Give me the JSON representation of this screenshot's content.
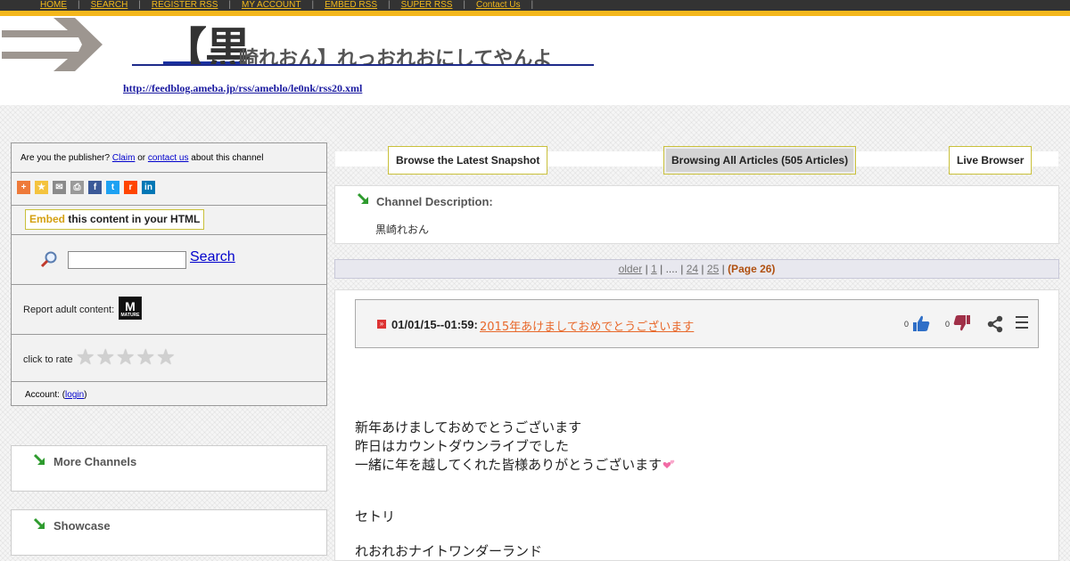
{
  "nav": {
    "items": [
      "HOME",
      "SEARCH",
      "REGISTER RSS",
      "MY ACCOUNT",
      "EMBED RSS",
      "SUPER RSS",
      "Contact Us"
    ],
    "separator": "|"
  },
  "header": {
    "title_big": "【黒",
    "title_rest": "崎れおん】れっおれおにしてやんよ",
    "feed_url": "http://feedblog.ameba.jp/rss/ameblo/le0nk/rss20.xml"
  },
  "sidebar": {
    "publisher": {
      "prefix": "Are you the publisher?",
      "claim": "Claim",
      "or": "or",
      "contact": "contact us",
      "suffix": "about this channel"
    },
    "share_icons": [
      "plus-icon",
      "star-icon",
      "mail-icon",
      "print-icon",
      "facebook-icon",
      "twitter-icon",
      "reddit-icon",
      "linkedin-icon"
    ],
    "embed": {
      "highlight": "Embed",
      "rest": "this content in your HTML"
    },
    "search": {
      "button": "Search",
      "value": ""
    },
    "adult": {
      "label": "Report adult content:",
      "badge_letter": "M",
      "badge_caption": "MATURE"
    },
    "rate": {
      "label": "click to rate",
      "stars": 5
    },
    "account": {
      "prefix": "Account: (",
      "login": "login",
      "suffix": ")"
    },
    "more_channels": "More Channels",
    "showcase": "Showcase"
  },
  "tabs": {
    "latest": "Browse the Latest Snapshot",
    "all": "Browsing All Articles (505 Articles)",
    "live": "Live Browser"
  },
  "description": {
    "label": "Channel Description:",
    "text": "黒崎れおん"
  },
  "pager": {
    "older": "older",
    "sep": "|",
    "p1": "1",
    "dots": "....",
    "p24": "24",
    "p25": "25",
    "current": "(Page 26)"
  },
  "article": {
    "timestamp": "01/01/15--01:59:",
    "title": "2015年あけましておめでとうございます",
    "upvotes": "0",
    "downvotes": "0",
    "body": {
      "line1": "新年あけましておめでとうございます",
      "line2": "昨日はカウントダウンライブでした",
      "line3": "一緒に年を越してくれた皆様ありがとうございます",
      "line4": "セトリ",
      "line5": "れおれおナイトワンダーランド"
    }
  },
  "colors": {
    "nav_bg": "#333333",
    "nav_link": "#f2b91b",
    "accent_yellow": "#f4b71c",
    "link_blue": "#0000cc",
    "article_title": "#e8682a",
    "pager_current": "#b05010"
  }
}
